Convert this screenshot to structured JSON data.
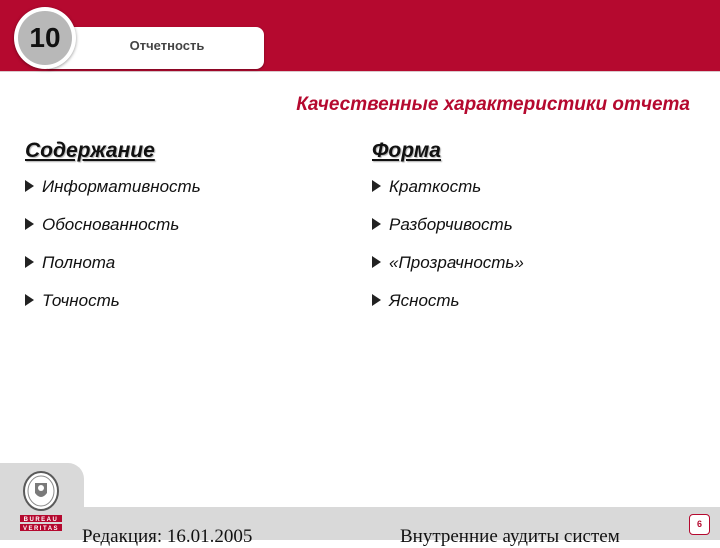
{
  "header": {
    "section_number": "10",
    "section_tab": "Отчетность"
  },
  "title": "Качественные характеристики отчета",
  "columns": [
    {
      "heading": "Содержание",
      "items": [
        "Информативность",
        "Обоснованность",
        "Полнота",
        "Точность"
      ]
    },
    {
      "heading": "Форма",
      "items": [
        "Краткость",
        "Разборчивость",
        "«Прозрачность»",
        "Ясность"
      ]
    }
  ],
  "footer": {
    "edition": "Редакция:  16.01.2005",
    "course": "Внутренние аудиты систем",
    "page_number": "6",
    "logo_text": [
      "BUREAU",
      "VERITAS"
    ]
  },
  "colors": {
    "brand": "#b5092f",
    "footer_gray": "#d9d9d9"
  }
}
